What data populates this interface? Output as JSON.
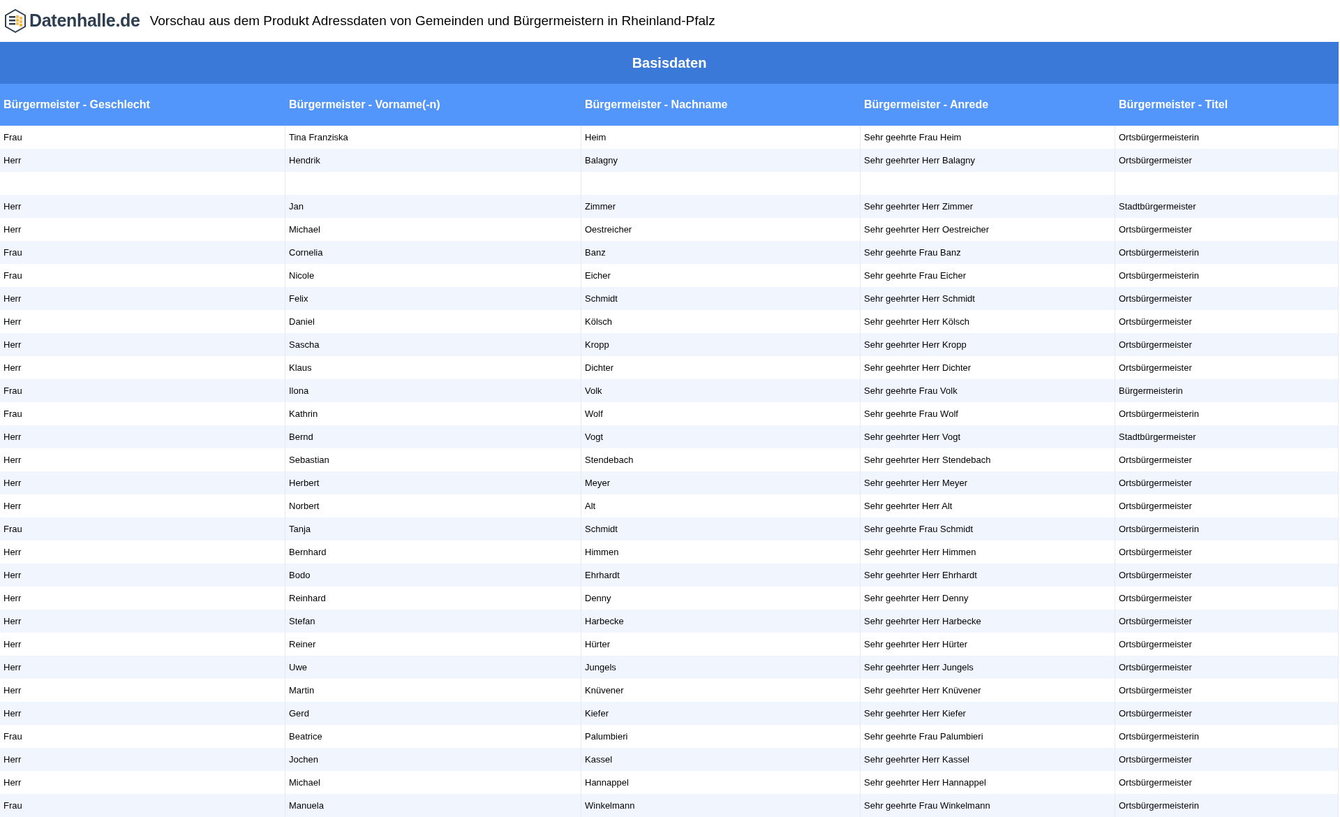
{
  "header": {
    "logo_text": "Datenhalle.de",
    "title": "Vorschau aus dem Produkt Adressdaten von Gemeinden und Bürgermeistern in Rheinland-Pfalz"
  },
  "table": {
    "group_heading": "Basisdaten",
    "columns": [
      "Bürgermeister - Geschlecht",
      "Bürgermeister - Vorname(-n)",
      "Bürgermeister - Nachname",
      "Bürgermeister - Anrede",
      "Bürgermeister - Titel"
    ],
    "rows": [
      {
        "kind": "data",
        "cells": [
          "Frau",
          "Tina Franziska",
          "Heim",
          "Sehr geehrte Frau Heim",
          "Ortsbürgermeisterin"
        ]
      },
      {
        "kind": "data",
        "cells": [
          "Herr",
          "Hendrik",
          "Balagny",
          "Sehr geehrter Herr Balagny",
          "Ortsbürgermeister"
        ]
      },
      {
        "kind": "empty"
      },
      {
        "kind": "data",
        "cells": [
          "Herr",
          "Jan",
          "Zimmer",
          "Sehr geehrter Herr Zimmer",
          "Stadtbürgermeister"
        ]
      },
      {
        "kind": "data",
        "cells": [
          "Herr",
          "Michael",
          "Oestreicher",
          "Sehr geehrter Herr Oestreicher",
          "Ortsbürgermeister"
        ]
      },
      {
        "kind": "data",
        "cells": [
          "Frau",
          "Cornelia",
          "Banz",
          "Sehr geehrte Frau Banz",
          "Ortsbürgermeisterin"
        ]
      },
      {
        "kind": "data",
        "cells": [
          "Frau",
          "Nicole",
          "Eicher",
          "Sehr geehrte Frau Eicher",
          "Ortsbürgermeisterin"
        ]
      },
      {
        "kind": "data",
        "cells": [
          "Herr",
          "Felix",
          "Schmidt",
          "Sehr geehrter Herr Schmidt",
          "Ortsbürgermeister"
        ]
      },
      {
        "kind": "data",
        "cells": [
          "Herr",
          "Daniel",
          "Kölsch",
          "Sehr geehrter Herr Kölsch",
          "Ortsbürgermeister"
        ]
      },
      {
        "kind": "data",
        "cells": [
          "Herr",
          "Sascha",
          "Kropp",
          "Sehr geehrter Herr Kropp",
          "Ortsbürgermeister"
        ]
      },
      {
        "kind": "data",
        "cells": [
          "Herr",
          "Klaus",
          "Dichter",
          "Sehr geehrter Herr Dichter",
          "Ortsbürgermeister"
        ]
      },
      {
        "kind": "data",
        "cells": [
          "Frau",
          "Ilona",
          "Volk",
          "Sehr geehrte Frau Volk",
          "Bürgermeisterin"
        ]
      },
      {
        "kind": "data",
        "cells": [
          "Frau",
          "Kathrin",
          "Wolf",
          "Sehr geehrte Frau Wolf",
          "Ortsbürgermeisterin"
        ]
      },
      {
        "kind": "data",
        "cells": [
          "Herr",
          "Bernd",
          "Vogt",
          "Sehr geehrter Herr Vogt",
          "Stadtbürgermeister"
        ]
      },
      {
        "kind": "data",
        "cells": [
          "Herr",
          "Sebastian",
          "Stendebach",
          "Sehr geehrter Herr Stendebach",
          "Ortsbürgermeister"
        ]
      },
      {
        "kind": "data",
        "cells": [
          "Herr",
          "Herbert",
          "Meyer",
          "Sehr geehrter Herr Meyer",
          "Ortsbürgermeister"
        ]
      },
      {
        "kind": "data",
        "cells": [
          "Herr",
          "Norbert",
          "Alt",
          "Sehr geehrter Herr Alt",
          "Ortsbürgermeister"
        ]
      },
      {
        "kind": "data",
        "cells": [
          "Frau",
          "Tanja",
          "Schmidt",
          "Sehr geehrte Frau Schmidt",
          "Ortsbürgermeisterin"
        ]
      },
      {
        "kind": "data",
        "cells": [
          "Herr",
          "Bernhard",
          "Himmen",
          "Sehr geehrter Herr Himmen",
          "Ortsbürgermeister"
        ]
      },
      {
        "kind": "data",
        "cells": [
          "Herr",
          "Bodo",
          "Ehrhardt",
          "Sehr geehrter Herr Ehrhardt",
          "Ortsbürgermeister"
        ]
      },
      {
        "kind": "data",
        "cells": [
          "Herr",
          "Reinhard",
          "Denny",
          "Sehr geehrter Herr Denny",
          "Ortsbürgermeister"
        ]
      },
      {
        "kind": "data",
        "cells": [
          "Herr",
          "Stefan",
          "Harbecke",
          "Sehr geehrter Herr Harbecke",
          "Ortsbürgermeister"
        ]
      },
      {
        "kind": "data",
        "cells": [
          "Herr",
          "Reiner",
          "Hürter",
          "Sehr geehrter Herr Hürter",
          "Ortsbürgermeister"
        ]
      },
      {
        "kind": "data",
        "cells": [
          "Herr",
          "Uwe",
          "Jungels",
          "Sehr geehrter Herr Jungels",
          "Ortsbürgermeister"
        ]
      },
      {
        "kind": "data",
        "cells": [
          "Herr",
          "Martin",
          "Knüvener",
          "Sehr geehrter Herr Knüvener",
          "Ortsbürgermeister"
        ]
      },
      {
        "kind": "data",
        "cells": [
          "Herr",
          "Gerd",
          "Kiefer",
          "Sehr geehrter Herr Kiefer",
          "Ortsbürgermeister"
        ]
      },
      {
        "kind": "data",
        "cells": [
          "Frau",
          "Beatrice",
          "Palumbieri",
          "Sehr geehrte Frau Palumbieri",
          "Ortsbürgermeisterin"
        ]
      },
      {
        "kind": "data",
        "cells": [
          "Herr",
          "Jochen",
          "Kassel",
          "Sehr geehrter Herr Kassel",
          "Ortsbürgermeister"
        ]
      },
      {
        "kind": "data",
        "cells": [
          "Herr",
          "Michael",
          "Hannappel",
          "Sehr geehrter Herr Hannappel",
          "Ortsbürgermeister"
        ]
      },
      {
        "kind": "data",
        "cells": [
          "Frau",
          "Manuela",
          "Winkelmann",
          "Sehr geehrte Frau Winkelmann",
          "Ortsbürgermeisterin"
        ]
      }
    ]
  }
}
